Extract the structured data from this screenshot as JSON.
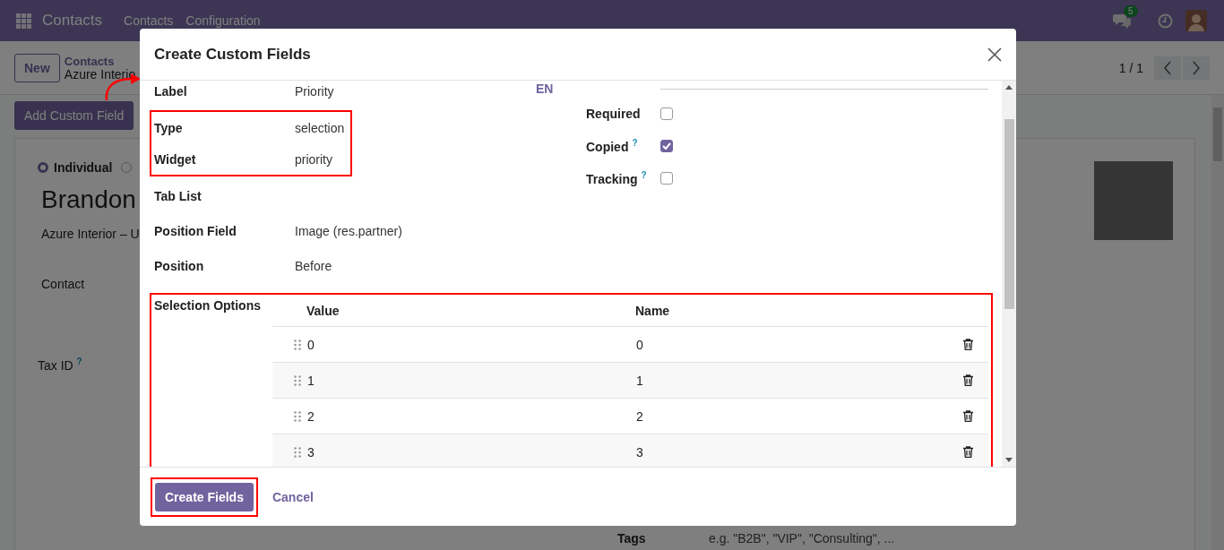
{
  "navbar": {
    "app_name": "Contacts",
    "menu": [
      "Contacts",
      "Configuration"
    ],
    "chat_count": "5"
  },
  "control_panel": {
    "new_button": "New",
    "breadcrumb": "Contacts",
    "record": "Azure Interio",
    "pager": "1 / 1"
  },
  "add_custom_field_button": "Add Custom Field",
  "form": {
    "company_type": [
      {
        "label": "Individual",
        "selected": true
      },
      {
        "selected": false
      }
    ],
    "name": "Brandon",
    "company": "Azure Interior – U",
    "contact_label": "Contact",
    "tax_id_label": "Tax ID",
    "tax_id_help": "?",
    "tags_label": "Tags",
    "tags_placeholder": "e.g. \"B2B\", \"VIP\", \"Consulting\", ..."
  },
  "dialog": {
    "title": "Create Custom Fields",
    "fields": [
      {
        "label": "Label",
        "value": "Priority",
        "highlighted": false
      },
      {
        "label": "Type",
        "value": "selection",
        "highlighted": true
      },
      {
        "label": "Widget",
        "value": "priority",
        "highlighted": true
      },
      {
        "label": "Tab List",
        "highlighted": false
      },
      {
        "label": "Position Field",
        "value": "Image (res.partner)",
        "highlighted": false
      },
      {
        "label": "Position",
        "value": "Before",
        "highlighted": false
      }
    ],
    "language": "EN",
    "options": [
      {
        "label": "Required",
        "checked": false
      },
      {
        "label": "Copied",
        "help": "?",
        "checked": true
      },
      {
        "label": "Tracking",
        "help": "?",
        "checked": false
      }
    ],
    "selection_options": {
      "label": "Selection Options",
      "highlighted": true,
      "columns": [
        "Value",
        "Name"
      ],
      "rows": [
        {
          "value": "0",
          "name": "0"
        },
        {
          "value": "1",
          "name": "1"
        },
        {
          "value": "2",
          "name": "2"
        },
        {
          "value": "3",
          "name": "3"
        }
      ]
    },
    "primary_button": {
      "label": "Create Fields",
      "highlighted": true
    },
    "secondary_button": "Cancel"
  }
}
